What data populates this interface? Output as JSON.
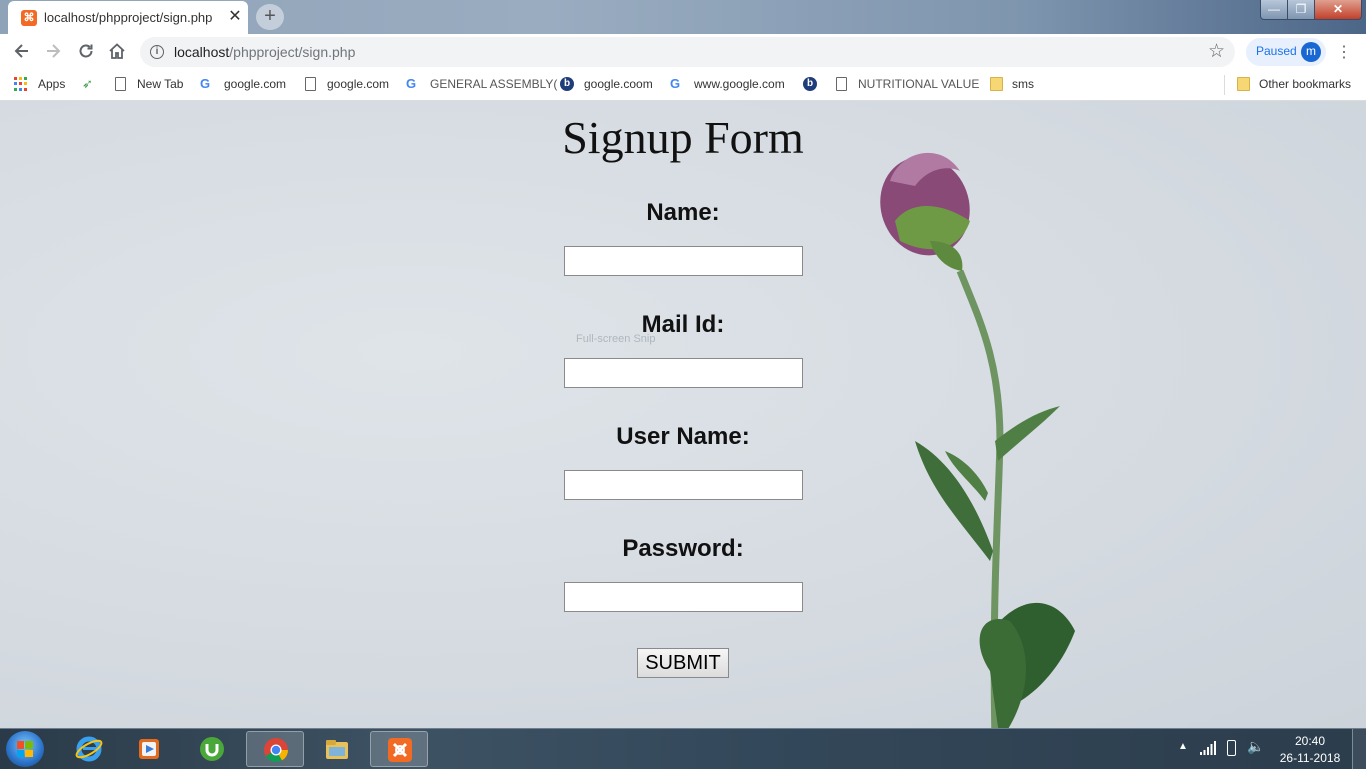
{
  "browser": {
    "tab": {
      "title": "localhost/phpproject/sign.php",
      "favicon": "xampp-icon"
    },
    "new_tab_symbol": "+",
    "window_controls": {
      "minimize": "—",
      "maximize": "❐",
      "close": "✕"
    },
    "address_bar": {
      "host": "localhost",
      "path": "/phpproject/sign.php"
    },
    "profile": {
      "status": "Paused",
      "initial": "m"
    },
    "bookmarks": [
      {
        "label": "Apps",
        "icon": "apps-grid-icon"
      },
      {
        "label": "",
        "icon": "arrows-icon"
      },
      {
        "label": "New Tab",
        "icon": "page-icon"
      },
      {
        "label": "google.com",
        "icon": "google-icon"
      },
      {
        "label": "google.com",
        "icon": "page-icon"
      },
      {
        "label": "GENERAL ASSEMBLY(",
        "icon": "google-icon"
      },
      {
        "label": "google.coom",
        "icon": "bing-icon"
      },
      {
        "label": "www.google.com",
        "icon": "google-icon"
      },
      {
        "label": "",
        "icon": "bing-icon"
      },
      {
        "label": "NUTRITIONAL VALUE",
        "icon": "page-icon"
      },
      {
        "label": "sms",
        "icon": "folder-icon"
      }
    ],
    "other_bookmarks": "Other bookmarks"
  },
  "form": {
    "title": "Signup Form",
    "fields": [
      {
        "label": "Name:",
        "value": ""
      },
      {
        "label": "Mail Id:",
        "value": ""
      },
      {
        "label": "User Name:",
        "value": ""
      },
      {
        "label": "Password:",
        "value": ""
      }
    ],
    "submit_label": "SUBMIT",
    "overlay_text": "Full-screen Snip"
  },
  "taskbar": {
    "apps": [
      "internet-explorer-icon",
      "media-player-icon",
      "utorrent-icon",
      "chrome-icon",
      "file-explorer-icon",
      "xampp-icon"
    ],
    "active_apps": [
      "chrome-icon",
      "xampp-icon"
    ],
    "clock": {
      "time": "20:40",
      "date": "26-11-2018"
    }
  },
  "colors": {
    "accent": "#1a73e8",
    "xampp": "#f26b25",
    "page_background": "#d9dfe5",
    "tab_strip": "#8fa3b8"
  }
}
